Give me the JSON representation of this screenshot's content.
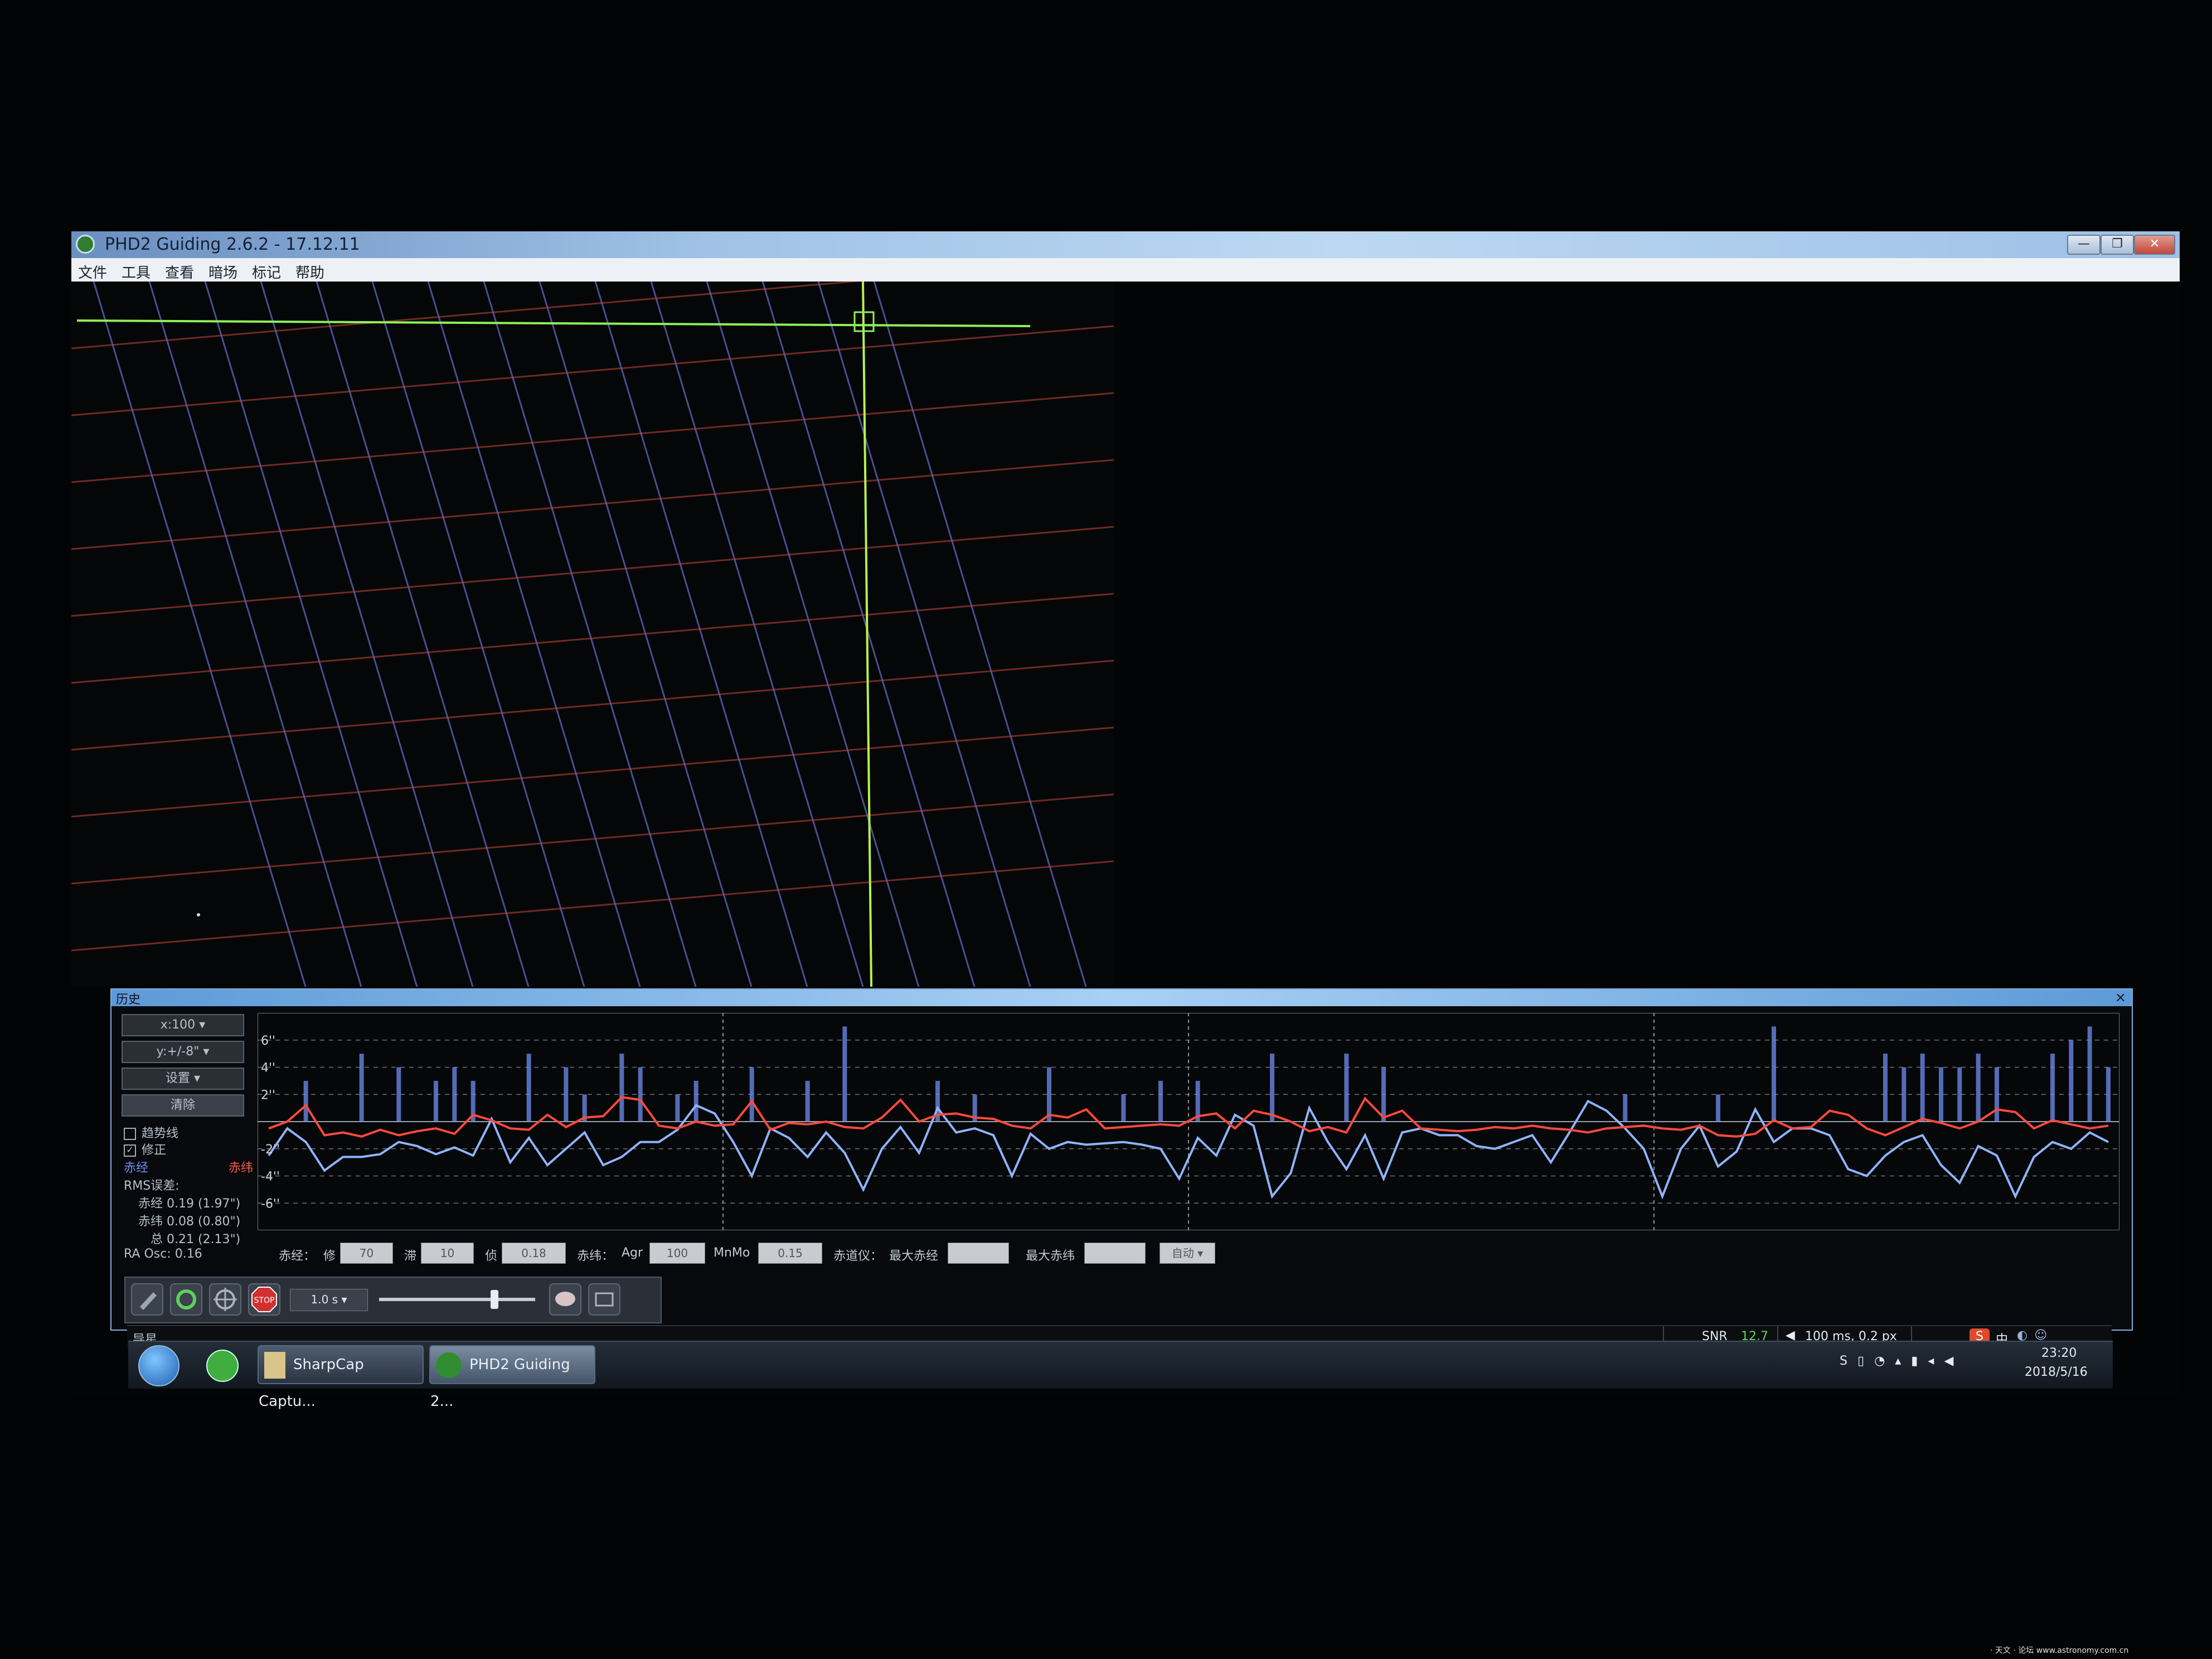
{
  "window": {
    "title": "PHD2 Guiding 2.6.2 - 17.12.11",
    "controls": {
      "minimize": "—",
      "maximize": "❐",
      "close": "✕"
    }
  },
  "menu": [
    "文件",
    "工具",
    "查看",
    "暗场",
    "标记",
    "帮助"
  ],
  "graph": {
    "title": "历史",
    "close": "×",
    "x_scale": "x:100",
    "y_scale": "y:+/-8\"",
    "settings": "设置",
    "clear": "清除",
    "trend_label": "趋势线",
    "trend_checked": false,
    "correction_label": "修正",
    "correction_checked": true,
    "legend_ra": "赤经",
    "legend_dec": "赤纬",
    "rms_label": "RMS误差:",
    "rms_ra": "赤经 0.19 (1.97\")",
    "rms_dec": "赤纬 0.08 (0.80\")",
    "rms_total": "总 0.21 (2.13\")",
    "ra_osc": "RA Osc: 0.16",
    "colors": {
      "ra": "#6f8ff0",
      "dec": "#ff5a4a",
      "ra_line": "#8fb4ff",
      "dec_line": "#ff4a3c"
    }
  },
  "params": {
    "ra_label": "赤经：",
    "ra_agg_label": "修",
    "ra_agg": "70",
    "ra_hyst_label": "滞",
    "ra_hyst": "10",
    "ra_min_label": "侦",
    "ra_min": "0.18",
    "dec_label": "赤纬：",
    "dec_agr_label": "Agr",
    "dec_agr": "100",
    "dec_minmo_label": "MnMo",
    "dec_minmo": "0.15",
    "mount_label": "赤道仪：",
    "max_ra_label": "最大赤经",
    "max_ra": "",
    "max_dec_label": "最大赤纬",
    "max_dec": "",
    "dec_mode": "自动"
  },
  "toolbar": {
    "exposure": "1.0 s"
  },
  "status": {
    "left": "导星",
    "snr_label": "SNR",
    "snr_value": "12.7",
    "pulse": "100 ms, 0.2 px"
  },
  "taskbar": {
    "sharpcap": "SharpCap Captu...",
    "phd2": "PHD2 Guiding 2...",
    "time": "23:20",
    "date": "2018/5/16",
    "ime": "中"
  },
  "watermark": "· 天文 ·  论坛    www.astronomy.com.cn",
  "chart_data": {
    "type": "line",
    "y_tick_labels": [
      "6''",
      "4''",
      "2''",
      "-2''",
      "-4''",
      "-6''"
    ],
    "ylim": [
      -8,
      8
    ],
    "x_count": 100,
    "series": [
      {
        "key": "ra",
        "values": [
          -2.5,
          -0.5,
          -1.5,
          -3.6,
          -2.6,
          -2.6,
          -2.4,
          -1.5,
          -1.8,
          -2.4,
          -1.9,
          -2.5,
          0.2,
          -3.0,
          -1.2,
          -3.2,
          -2.0,
          -0.8,
          -3.2,
          -2.6,
          -1.5,
          -1.5,
          -0.6,
          1.2,
          0.6,
          -1.5,
          -4.0,
          -0.5,
          -1.2,
          -2.6,
          -0.8,
          -2.3,
          -5.0,
          -2.0,
          -0.4,
          -2.3,
          1.0,
          -0.8,
          -0.5,
          -1.0,
          -4.0,
          -0.9,
          -2.0,
          -1.5,
          -1.7,
          -1.6,
          -1.5,
          -1.7,
          -2.0,
          -4.2,
          -1.2,
          -2.5,
          0.5,
          -0.3,
          -5.5,
          -3.8,
          1.0,
          -1.5,
          -3.5,
          -1.0,
          -4.2,
          -0.8,
          -0.5,
          -1.0,
          -1.0,
          -1.8,
          -2.0,
          -1.5,
          -1.0,
          -3.0,
          -0.8,
          1.5,
          0.8,
          -0.5,
          -2.0,
          -5.5,
          -2.0,
          -0.3,
          -3.3,
          -2.2,
          0.9,
          -1.5,
          -0.5,
          -0.5,
          -1.0,
          -3.5,
          -4.0,
          -2.5,
          -1.5,
          -1.0,
          -3.2,
          -4.5,
          -1.8,
          -2.5,
          -5.5,
          -2.6,
          -1.5,
          -2.0,
          -0.8,
          -1.5
        ]
      },
      {
        "key": "dec",
        "values": [
          -0.5,
          0.0,
          1.2,
          -1.0,
          -0.8,
          -1.1,
          -0.6,
          -1.0,
          -0.7,
          -0.5,
          -0.9,
          0.5,
          0.1,
          -0.5,
          -0.6,
          0.5,
          -0.4,
          0.3,
          0.4,
          1.8,
          1.6,
          -0.3,
          -0.5,
          0.0,
          -0.3,
          -0.2,
          1.5,
          -0.6,
          -0.1,
          -0.2,
          0.0,
          -0.4,
          -0.5,
          0.3,
          1.6,
          0.0,
          0.5,
          0.6,
          0.3,
          0.2,
          -0.3,
          -0.5,
          0.5,
          0.3,
          0.9,
          -0.5,
          -0.4,
          -0.3,
          -0.2,
          -0.3,
          0.4,
          0.6,
          -0.5,
          0.8,
          0.5,
          0.0,
          -0.7,
          -0.4,
          -0.8,
          1.7,
          0.3,
          0.8,
          -0.5,
          -0.6,
          -0.7,
          -0.6,
          -0.4,
          -0.5,
          -0.3,
          -0.5,
          -0.6,
          -0.8,
          -0.5,
          -0.4,
          -0.3,
          -0.5,
          -0.6,
          -0.3,
          -1.0,
          -1.1,
          -0.9,
          0.1,
          -0.5,
          -0.4,
          0.8,
          0.5,
          -0.5,
          -1.0,
          -0.4,
          0.2,
          -0.1,
          -0.5,
          0.0,
          0.9,
          0.7,
          -0.5,
          0.1,
          -0.2,
          -0.5,
          -0.3
        ]
      }
    ],
    "ra_pulses": [
      0,
      0,
      3,
      0,
      0,
      5,
      0,
      4,
      0,
      3,
      4,
      3,
      0,
      0,
      5,
      0,
      4,
      2,
      0,
      5,
      4,
      0,
      2,
      3,
      0,
      0,
      4,
      0,
      0,
      3,
      0,
      7,
      0,
      0,
      0,
      0,
      3,
      0,
      2,
      0,
      0,
      0,
      4,
      0,
      0,
      0,
      2,
      0,
      3,
      0,
      3,
      0,
      0,
      0,
      5,
      0,
      0,
      0,
      5,
      0,
      4,
      0,
      0,
      0,
      0,
      0,
      0,
      0,
      0,
      0,
      0,
      0,
      0,
      2,
      0,
      0,
      0,
      0,
      2,
      0,
      0,
      7,
      0,
      0,
      0,
      0,
      0,
      5,
      4,
      5,
      4,
      4,
      5,
      4,
      0,
      0,
      5,
      6,
      7,
      4,
      3,
      4
    ]
  }
}
